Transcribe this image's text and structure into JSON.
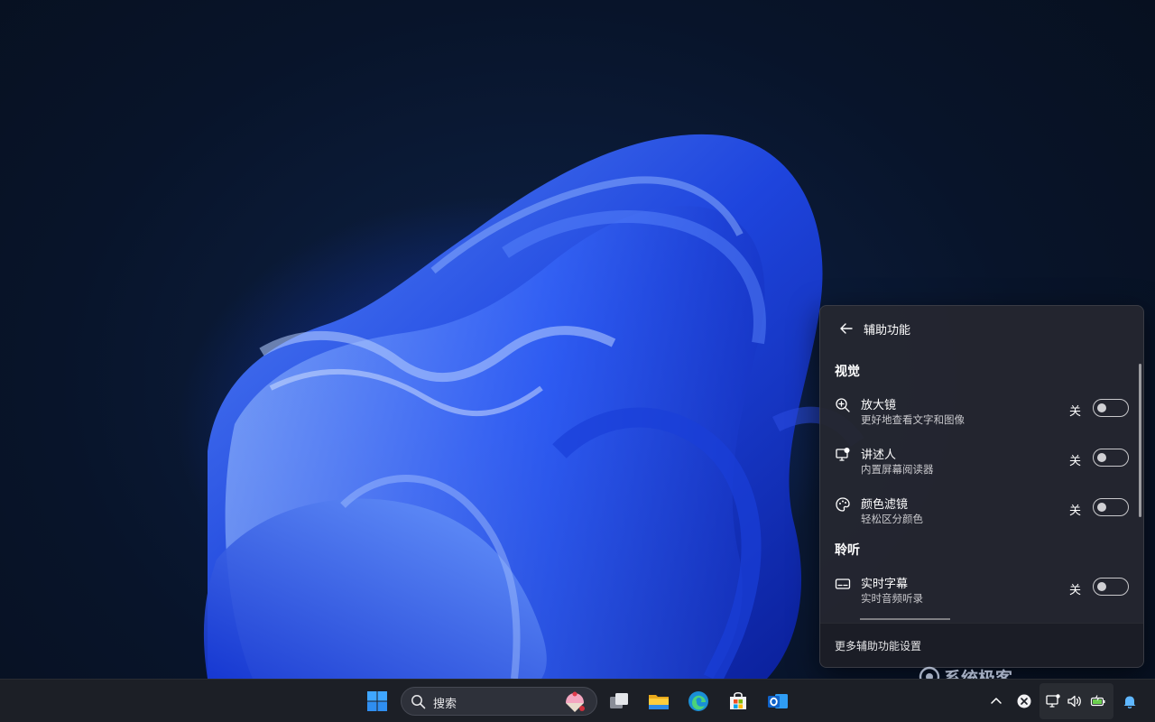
{
  "panel": {
    "title": "辅助功能",
    "sections": [
      {
        "label": "视觉",
        "items": [
          {
            "name": "放大镜",
            "description": "更好地查看文字和图像",
            "state": "关",
            "icon": "magnifier-icon"
          },
          {
            "name": "讲述人",
            "description": "内置屏幕阅读器",
            "state": "关",
            "icon": "narrator-icon"
          },
          {
            "name": "颜色滤镜",
            "description": "轻松区分颜色",
            "state": "关",
            "icon": "color-filter-icon"
          }
        ]
      },
      {
        "label": "聆听",
        "items": [
          {
            "name": "实时字幕",
            "description": "实时音频听录",
            "state": "关",
            "icon": "live-captions-icon"
          }
        ]
      }
    ],
    "footer_link": "更多辅助功能设置"
  },
  "watermark": {
    "text": "系统极客"
  },
  "taskbar": {
    "search_placeholder": "搜索",
    "apps": [
      "start-icon",
      "task-view-icon",
      "file-explorer-icon",
      "edge-icon",
      "store-icon",
      "outlook-icon"
    ],
    "tray": [
      "chevron-up-icon",
      "status-x-icon",
      "network-icon",
      "volume-icon",
      "battery-icon",
      "notification-bell-icon"
    ]
  },
  "colors": {
    "accent": "#1a56ff",
    "panel_bg": "#24262f",
    "taskbar_bg": "#1c1f26"
  }
}
